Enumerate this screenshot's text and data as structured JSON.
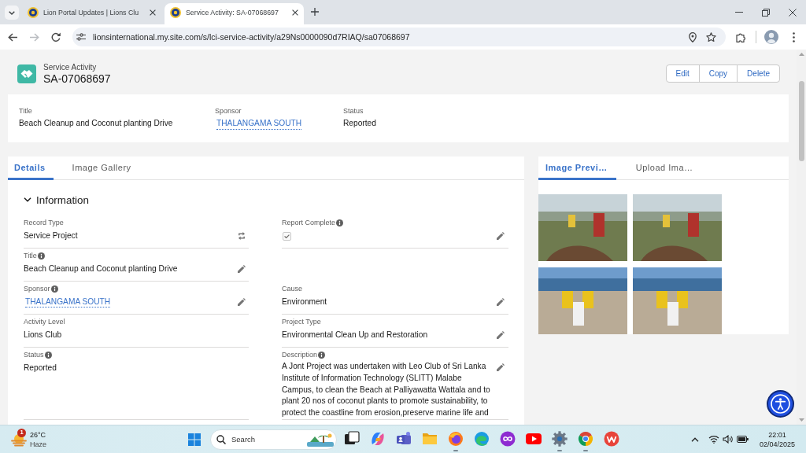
{
  "browser": {
    "tabs": [
      {
        "title": "Lion Portal Updates | Lions Clu",
        "selected": false
      },
      {
        "title": "Service Activity: SA-07068697",
        "selected": true
      }
    ],
    "nav": [
      {
        "kind": "back",
        "disabled": false
      },
      {
        "kind": "forward",
        "disabled": true
      },
      {
        "kind": "reload",
        "disabled": false
      }
    ],
    "address": "lionsinternational.my.site.com/s/lci-service-activity/a29Ns0000090d7RIAQ/sa07068697"
  },
  "record": {
    "object": "Service Activity",
    "name": "SA-07068697",
    "actions": [
      "Edit",
      "Copy",
      "Delete"
    ],
    "highlights": [
      {
        "label": "Title",
        "value": "Beach Cleanup and Coconut planting Drive",
        "kind": "text"
      },
      {
        "label": "Sponsor",
        "value": "THALANGAMA SOUTH",
        "kind": "link"
      },
      {
        "label": "Status",
        "value": "Reported",
        "kind": "text"
      }
    ]
  },
  "details": {
    "tabs": [
      {
        "label": "Details",
        "selected": true
      },
      {
        "label": "Image Gallery",
        "selected": false
      }
    ],
    "section": {
      "title": "Information",
      "expanded": true
    },
    "rows": [
      {
        "left": {
          "label": "Record Type",
          "kind": "text",
          "value": "Service Project",
          "info": false,
          "editable": false,
          "changeable": true
        },
        "right": {
          "label": "Report Complete",
          "kind": "checkbox",
          "checked": true,
          "info": true,
          "editable": true,
          "changeable": false
        }
      },
      {
        "left": {
          "label": "Title",
          "kind": "text",
          "value": "Beach Cleanup and Coconut planting Drive",
          "info": true,
          "editable": true,
          "changeable": false
        }
      },
      {
        "left": {
          "label": "Sponsor",
          "kind": "link",
          "value": "THALANGAMA SOUTH",
          "info": true,
          "editable": true,
          "changeable": false
        },
        "right": {
          "label": "Cause",
          "kind": "text",
          "value": "Environment",
          "info": false,
          "editable": true,
          "changeable": false
        }
      },
      {
        "left": {
          "label": "Activity Level",
          "kind": "text",
          "value": "Lions Club",
          "info": false,
          "editable": false,
          "changeable": false
        },
        "right": {
          "label": "Project Type",
          "kind": "text",
          "value": "Environmental Clean Up and Restoration",
          "info": false,
          "editable": true,
          "changeable": false
        }
      },
      {
        "left": {
          "label": "Status",
          "kind": "text",
          "value": "Reported",
          "info": true,
          "editable": false,
          "changeable": false
        },
        "right": {
          "label": "Description",
          "kind": "long_text",
          "value": "A Jont Project was undertaken with Leo Club of Sri Lanka Institute of Information Technology (SLITT) Malabe Campus, to clean the Beach at Palliyawatta Wattala and to plant 20 nos of coconut plants to promote sustainability, to protect the coastline from erosion,preserve marine life and",
          "info": true,
          "editable": true,
          "changeable": false
        }
      }
    ]
  },
  "gallery": {
    "tabs": [
      {
        "label": "Image Previ…",
        "selected": true
      },
      {
        "label": "Upload Ima…",
        "selected": false
      }
    ],
    "photos": [
      {
        "kind": "field"
      },
      {
        "kind": "field"
      },
      {
        "kind": "beach"
      },
      {
        "kind": "beach"
      }
    ]
  },
  "taskbar": {
    "weather": {
      "temperature": "26°C",
      "condition": "Haze",
      "badge": "1"
    },
    "search": {
      "placeholder": "Search"
    },
    "apps": [
      {
        "kind": "task-view",
        "running": false
      },
      {
        "kind": "copilot",
        "running": false
      },
      {
        "kind": "teams",
        "running": false
      },
      {
        "kind": "files",
        "running": false
      },
      {
        "kind": "firefox",
        "running": true
      },
      {
        "kind": "edge",
        "running": false
      },
      {
        "kind": "loop",
        "running": false
      },
      {
        "kind": "video",
        "running": false
      },
      {
        "kind": "settings",
        "running": true
      },
      {
        "kind": "chrome",
        "running": true
      },
      {
        "kind": "office",
        "running": false
      }
    ],
    "time": "22:01",
    "date": "02/04/2025"
  }
}
